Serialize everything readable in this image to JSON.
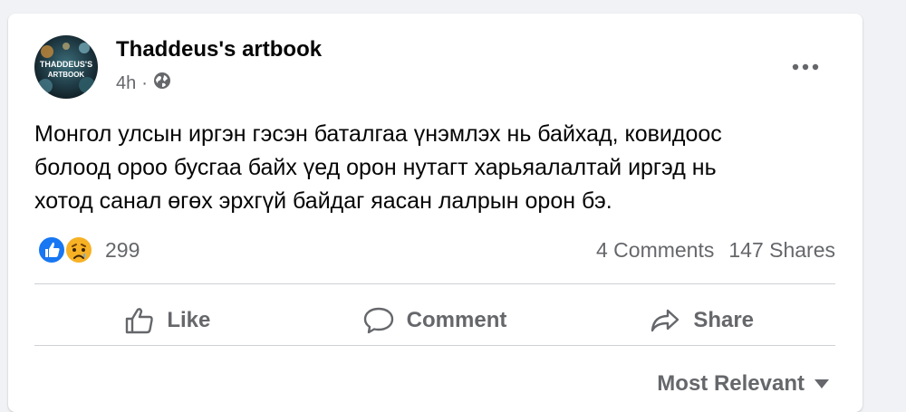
{
  "post": {
    "author": "Thaddeus's artbook",
    "avatar_text_line1": "THADDEUS'S",
    "avatar_text_line2": "ARTBOOK",
    "time": "4h",
    "separator": "·",
    "privacy_icon": "globe-icon",
    "more_icon": "more-options-icon",
    "text_lines": [
      "Монгол улсын иргэн гэсэн баталгаа үнэмлэх нь байхад, ковидоос",
      "болоод ороо бусгаа байх үед орон нутагт харьяалалтай иргэд нь",
      "хотод санал өгөх эрхгүй байдаг яасан лалрын орон бэ."
    ]
  },
  "reactions": {
    "icons": [
      "like-reaction-icon",
      "sad-reaction-icon"
    ],
    "count": "299",
    "comments": "4 Comments",
    "shares": "147 Shares"
  },
  "actions": {
    "like": "Like",
    "comment": "Comment",
    "share": "Share"
  },
  "comments_sort": {
    "label": "Most Relevant",
    "icon": "caret-down-icon"
  },
  "colors": {
    "background": "#f0f2f5",
    "card": "#ffffff",
    "secondary_text": "#65676b",
    "like_blue": "#1877f2",
    "sad_yellow": "#f7b125"
  }
}
